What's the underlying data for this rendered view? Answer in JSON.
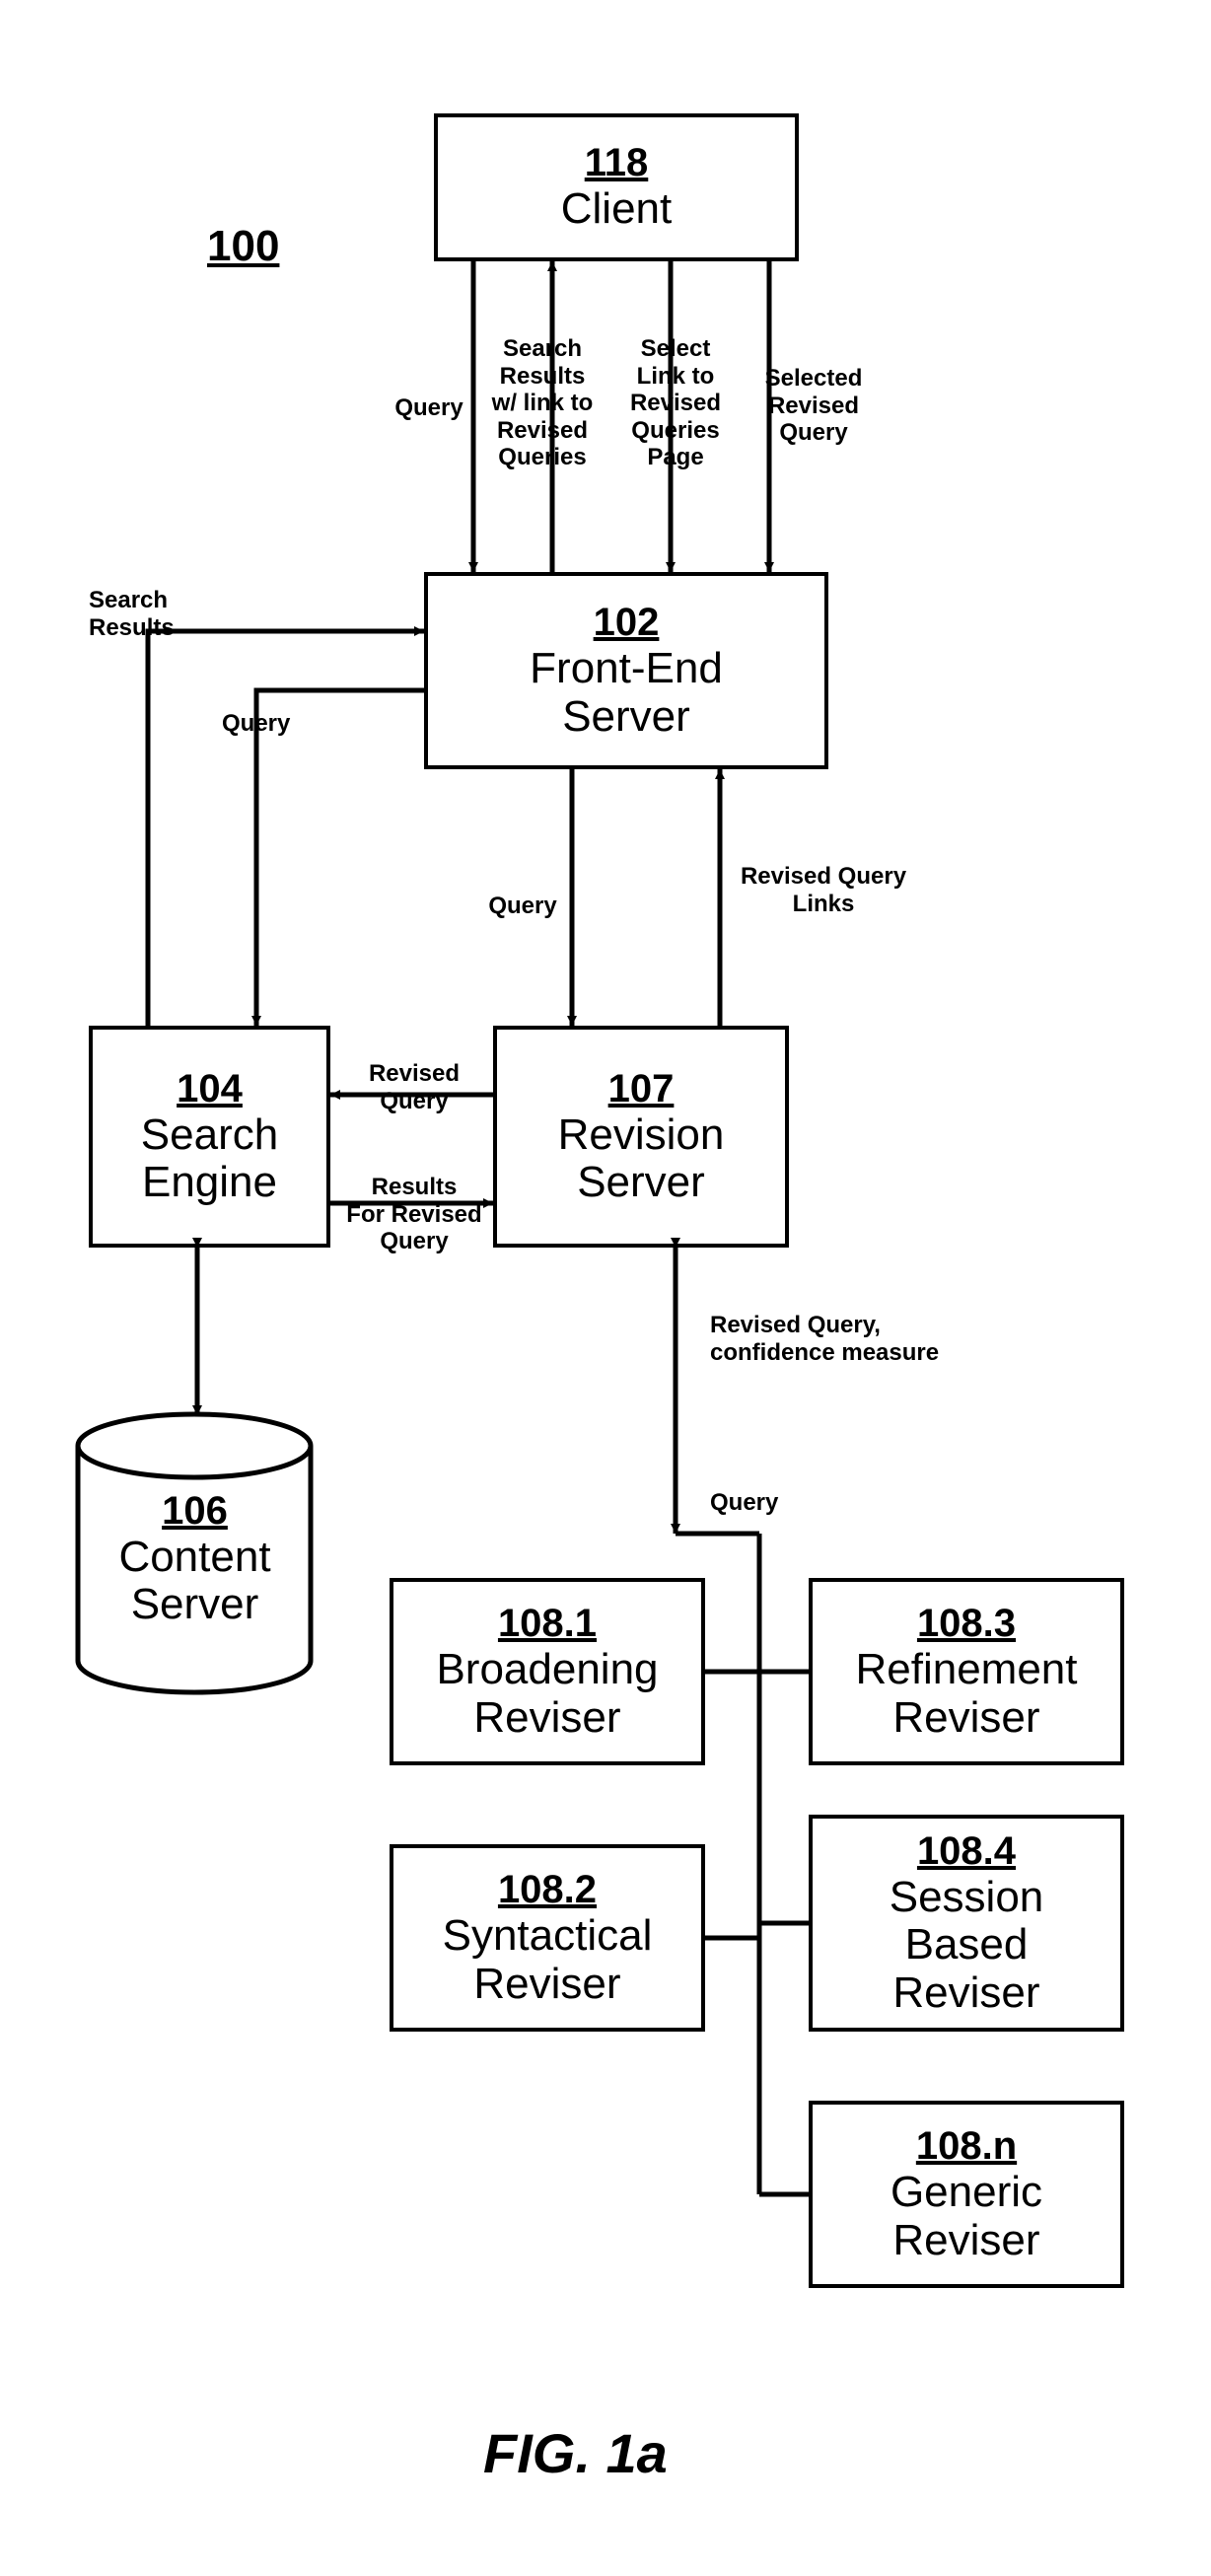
{
  "nodes": {
    "client": {
      "num": "118",
      "label": "Client"
    },
    "frontend": {
      "num": "102",
      "label": "Front-End\nServer"
    },
    "searchengine": {
      "num": "104",
      "label": "Search\nEngine"
    },
    "contentserver": {
      "num": "106",
      "label": "Content\nServer"
    },
    "revision": {
      "num": "107",
      "label": "Revision\nServer"
    },
    "broadening": {
      "num": "108.1",
      "label": "Broadening\nReviser"
    },
    "syntactical": {
      "num": "108.2",
      "label": "Syntactical\nReviser"
    },
    "refinement": {
      "num": "108.3",
      "label": "Refinement\nReviser"
    },
    "session": {
      "num": "108.4",
      "label": "Session\nBased\nReviser"
    },
    "generic": {
      "num": "108.n",
      "label": "Generic\nReviser"
    }
  },
  "system_label": "100",
  "edges": {
    "cli_query": "Query",
    "cli_results": "Search\nResults\nw/ link to\nRevised\nQueries",
    "cli_select_link": "Select\nLink to\nRevised\nQueries\nPage",
    "cli_sel_rev": "Selected\nRevised\nQuery",
    "se_results": "Search\nResults",
    "se_query": "Query",
    "fe_rv_query": "Query",
    "rv_links": "Revised Query\nLinks",
    "rv_se_query": "Revised\nQuery",
    "se_rv_results": "Results\nFor Revised\nQuery",
    "rv_confidence": "Revised Query,\nconfidence measure",
    "rv_revisers_q": "Query"
  },
  "figure_caption": "FIG. 1a"
}
